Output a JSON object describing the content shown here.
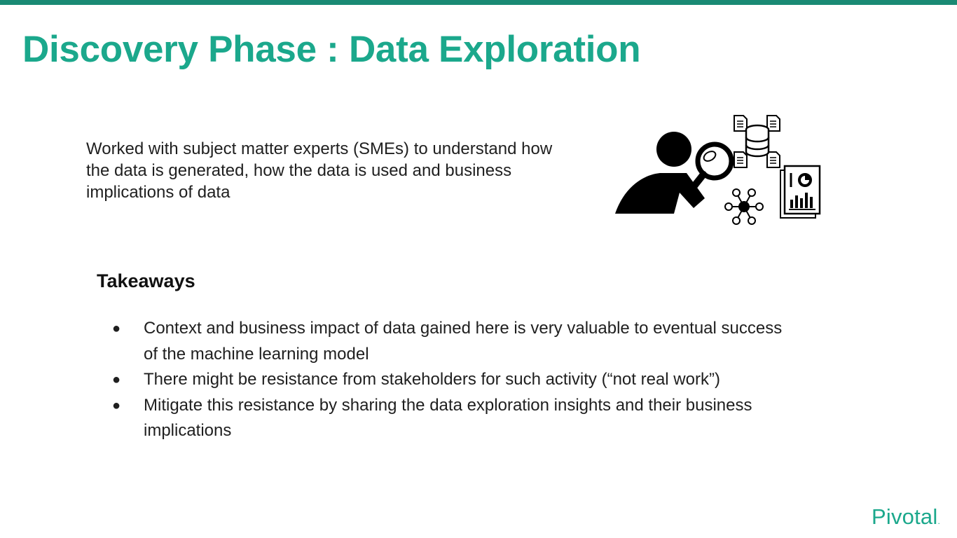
{
  "slide": {
    "title": "Discovery Phase : Data Exploration",
    "intro": "Worked with subject matter experts (SMEs) to understand how the data is generated, how the data is used and business implications of data",
    "takeaways_heading": "Takeaways",
    "bullets": [
      "Context and business impact of data gained here is very valuable to eventual success of the machine learning model",
      "There might be resistance from stakeholders for such activity (“not real work”)",
      "Mitigate this resistance by sharing the data exploration insights and their business implications"
    ],
    "bullet_glyph": "●",
    "logo_text": "Pivotal",
    "logo_dot": ".",
    "illustration_icon": "person-magnifier-data-icon"
  },
  "colors": {
    "brand": "#1ba88c",
    "top_bar": "#1a8a74",
    "text": "#1f1f1f"
  }
}
